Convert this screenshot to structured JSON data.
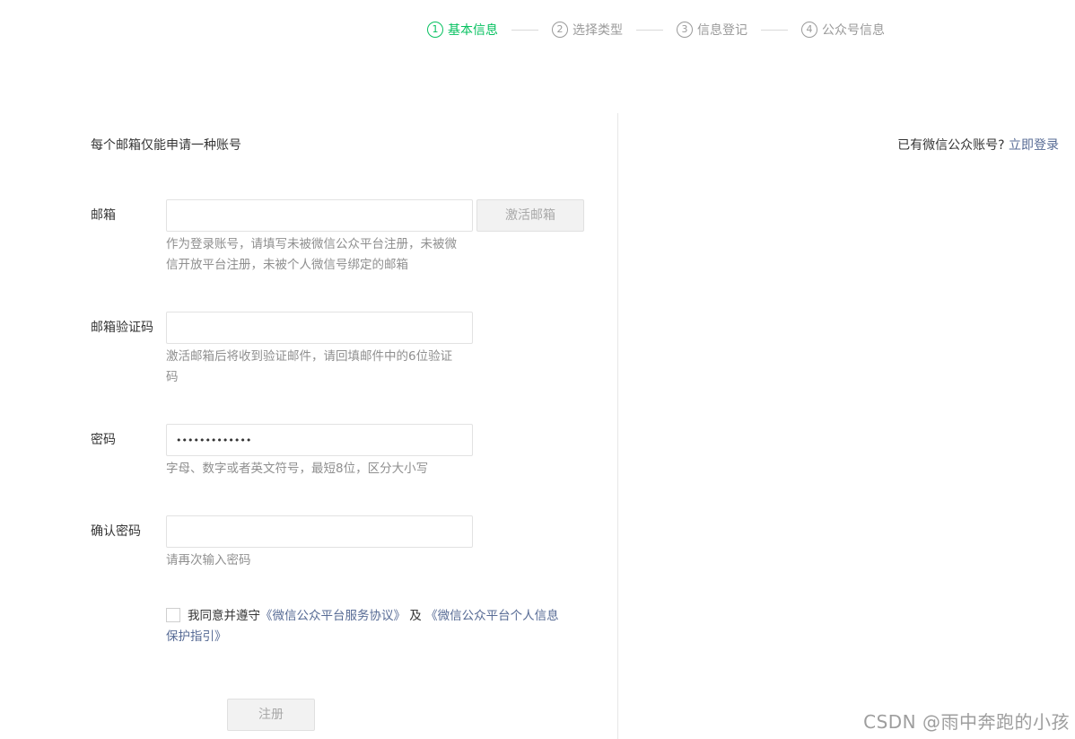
{
  "steps": [
    {
      "num": "1",
      "label": "基本信息",
      "active": true
    },
    {
      "num": "2",
      "label": "选择类型",
      "active": false
    },
    {
      "num": "3",
      "label": "信息登记",
      "active": false
    },
    {
      "num": "4",
      "label": "公众号信息",
      "active": false
    }
  ],
  "notice": "每个邮箱仅能申请一种账号",
  "login": {
    "question": "已有微信公众账号?",
    "link": "立即登录"
  },
  "form": {
    "email": {
      "label": "邮箱",
      "value": "",
      "button": "激活邮箱",
      "hint": "作为登录账号，请填写未被微信公众平台注册，未被微信开放平台注册，未被个人微信号绑定的邮箱"
    },
    "code": {
      "label": "邮箱验证码",
      "value": "",
      "hint": "激活邮箱后将收到验证邮件，请回填邮件中的6位验证码"
    },
    "password": {
      "label": "密码",
      "value": "•••••••••••••",
      "hint": "字母、数字或者英文符号，最短8位，区分大小写"
    },
    "confirm": {
      "label": "确认密码",
      "value": "",
      "hint": "请再次输入密码"
    }
  },
  "agreement": {
    "prefix": "我同意并遵守",
    "link1": "《微信公众平台服务协议》",
    "and": " 及 ",
    "link2": "《微信公众平台个人信息保护指引》",
    "checked": false
  },
  "register_button": "注册",
  "watermark": "CSDN @雨中奔跑的小孩",
  "colors": {
    "accent": "#07c160",
    "link": "#576b95",
    "hint": "#8f8f8f"
  }
}
